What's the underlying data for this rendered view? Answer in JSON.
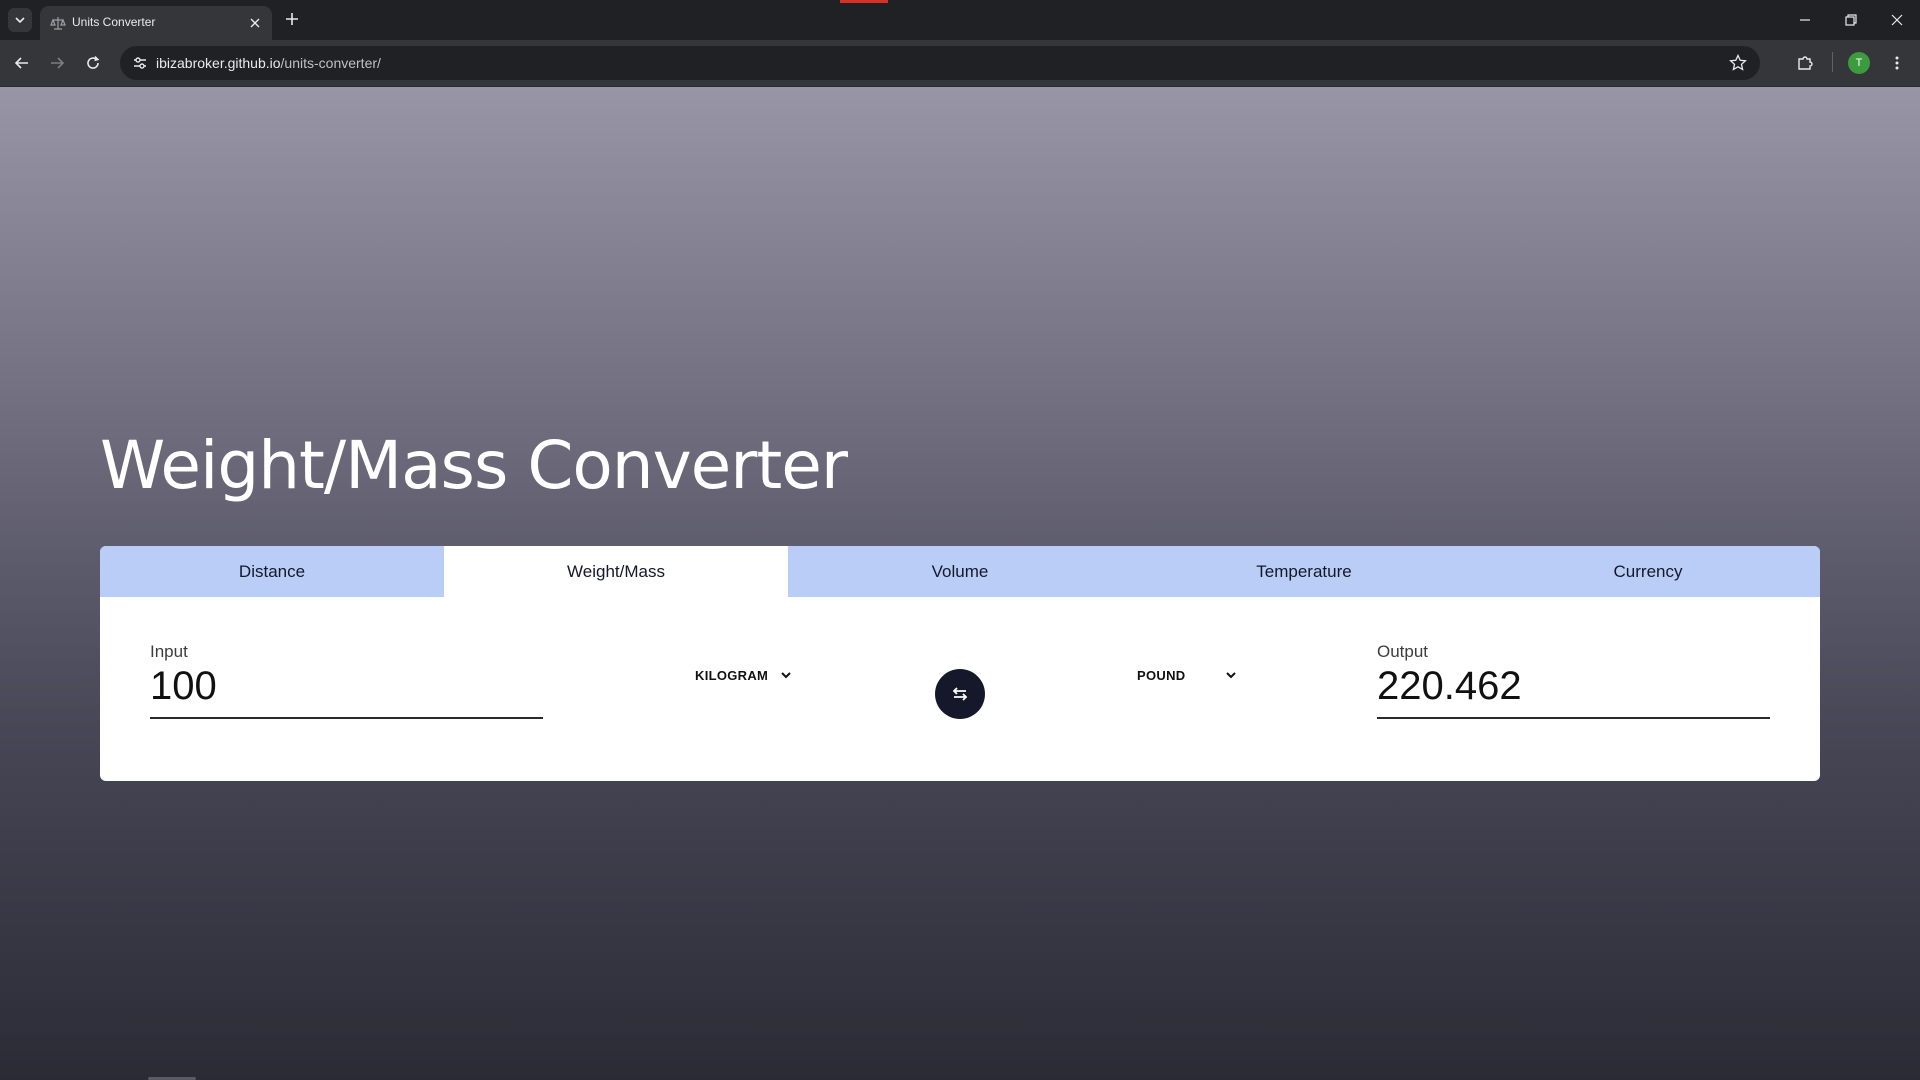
{
  "browser": {
    "tab_title": "Units Converter",
    "url_host": "ibizabroker.github.io",
    "url_path": "/units-converter/",
    "profile_initial": "T"
  },
  "page": {
    "title": "Weight/Mass Converter",
    "tabs": [
      {
        "label": "Distance",
        "active": false
      },
      {
        "label": "Weight/Mass",
        "active": true
      },
      {
        "label": "Volume",
        "active": false
      },
      {
        "label": "Temperature",
        "active": false
      },
      {
        "label": "Currency",
        "active": false
      }
    ],
    "input": {
      "label": "Input",
      "value": "100",
      "unit": "KILOGRAM"
    },
    "output": {
      "label": "Output",
      "value": "220.462",
      "unit": "POUND"
    }
  },
  "colors": {
    "tab_bar": "#b9cdf7",
    "accent_dark": "#15182a",
    "profile_badge": "#3c9a3f"
  }
}
